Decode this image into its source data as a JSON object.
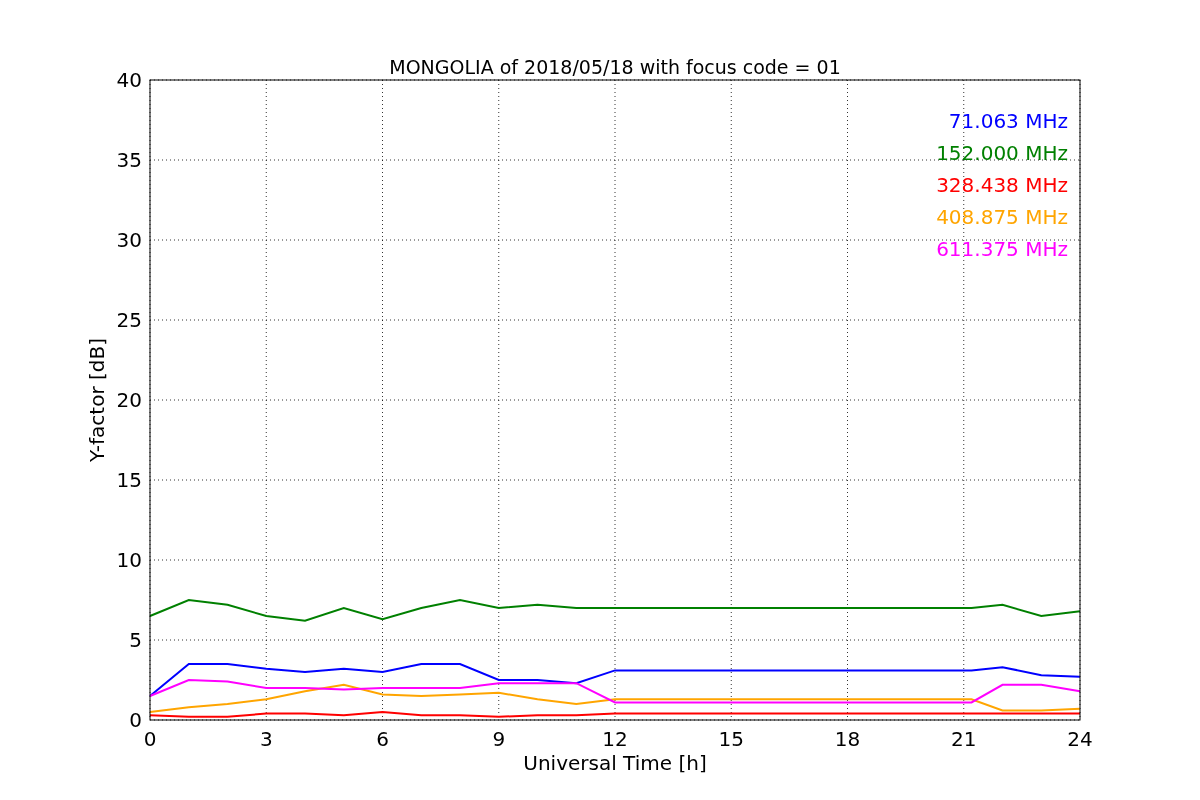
{
  "chart_data": {
    "type": "line",
    "title": "MONGOLIA of 2018/05/18 with focus code = 01",
    "xlabel": "Universal Time [h]",
    "ylabel": "Y-factor [dB]",
    "x": [
      0,
      1,
      2,
      3,
      4,
      5,
      6,
      7,
      8,
      9,
      10,
      11,
      12,
      21.2,
      22,
      23,
      24
    ],
    "series": [
      {
        "name": "71.063 MHz",
        "color": "#0000ff",
        "values": [
          1.5,
          3.5,
          3.5,
          3.2,
          3,
          3.2,
          3,
          3.5,
          3.5,
          2.5,
          2.5,
          2.3,
          3.1,
          3.1,
          3.3,
          2.8,
          2.7
        ]
      },
      {
        "name": "152.000 MHz",
        "color": "#008000",
        "values": [
          6.5,
          7.5,
          7.2,
          6.5,
          6.2,
          7,
          6.3,
          7,
          7.5,
          7,
          7.2,
          7,
          7,
          7,
          7.2,
          6.5,
          6.8
        ]
      },
      {
        "name": "328.438 MHz",
        "color": "#ff0000",
        "values": [
          0.3,
          0.2,
          0.2,
          0.4,
          0.4,
          0.3,
          0.5,
          0.3,
          0.3,
          0.2,
          0.3,
          0.3,
          0.4,
          0.4,
          0.4,
          0.4,
          0.4
        ]
      },
      {
        "name": "408.875 MHz",
        "color": "#ffa500",
        "values": [
          0.5,
          0.8,
          1,
          1.3,
          1.8,
          2.2,
          1.6,
          1.5,
          1.6,
          1.7,
          1.3,
          1,
          1.3,
          1.3,
          0.6,
          0.6,
          0.7
        ]
      },
      {
        "name": "611.375 MHz",
        "color": "#ff00ff",
        "values": [
          1.5,
          2.5,
          2.4,
          2,
          2,
          1.9,
          2,
          2,
          2,
          2.3,
          2.3,
          2.3,
          1.1,
          1.1,
          2.2,
          2.2,
          1.8
        ]
      }
    ],
    "xlim": [
      0,
      24
    ],
    "ylim": [
      0,
      40
    ],
    "xticks": [
      0,
      3,
      6,
      9,
      12,
      15,
      18,
      21,
      24
    ],
    "yticks": [
      0,
      5,
      10,
      15,
      20,
      25,
      30,
      35,
      40
    ],
    "grid": true
  }
}
